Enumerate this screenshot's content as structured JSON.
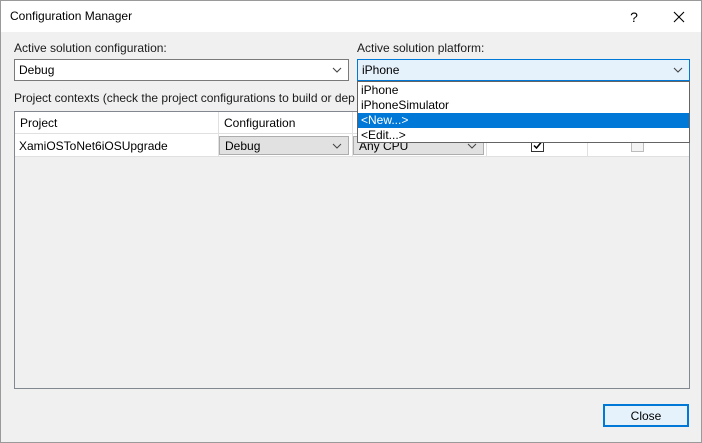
{
  "window": {
    "title": "Configuration Manager",
    "help_label": "?"
  },
  "config": {
    "active_config_label": "Active solution configuration:",
    "active_config_value": "Debug",
    "active_platform_label": "Active solution platform:",
    "active_platform_value": "iPhone"
  },
  "platform_dropdown": {
    "items": [
      "iPhone",
      "iPhoneSimulator",
      "<New...>",
      "<Edit...>"
    ],
    "selected": "<New...>"
  },
  "contexts": {
    "label": "Project contexts (check the project configurations to build or dep",
    "columns": [
      "Project",
      "Configuration",
      "",
      "",
      ""
    ],
    "rows": [
      {
        "project": "XamiOSToNet6iOSUpgrade",
        "configuration": "Debug",
        "platform": "Any CPU",
        "build": true,
        "deploy": false
      }
    ]
  },
  "buttons": {
    "close": "Close"
  },
  "colors": {
    "accent": "#0078d7",
    "dialog_bg": "#f0f0f0"
  }
}
